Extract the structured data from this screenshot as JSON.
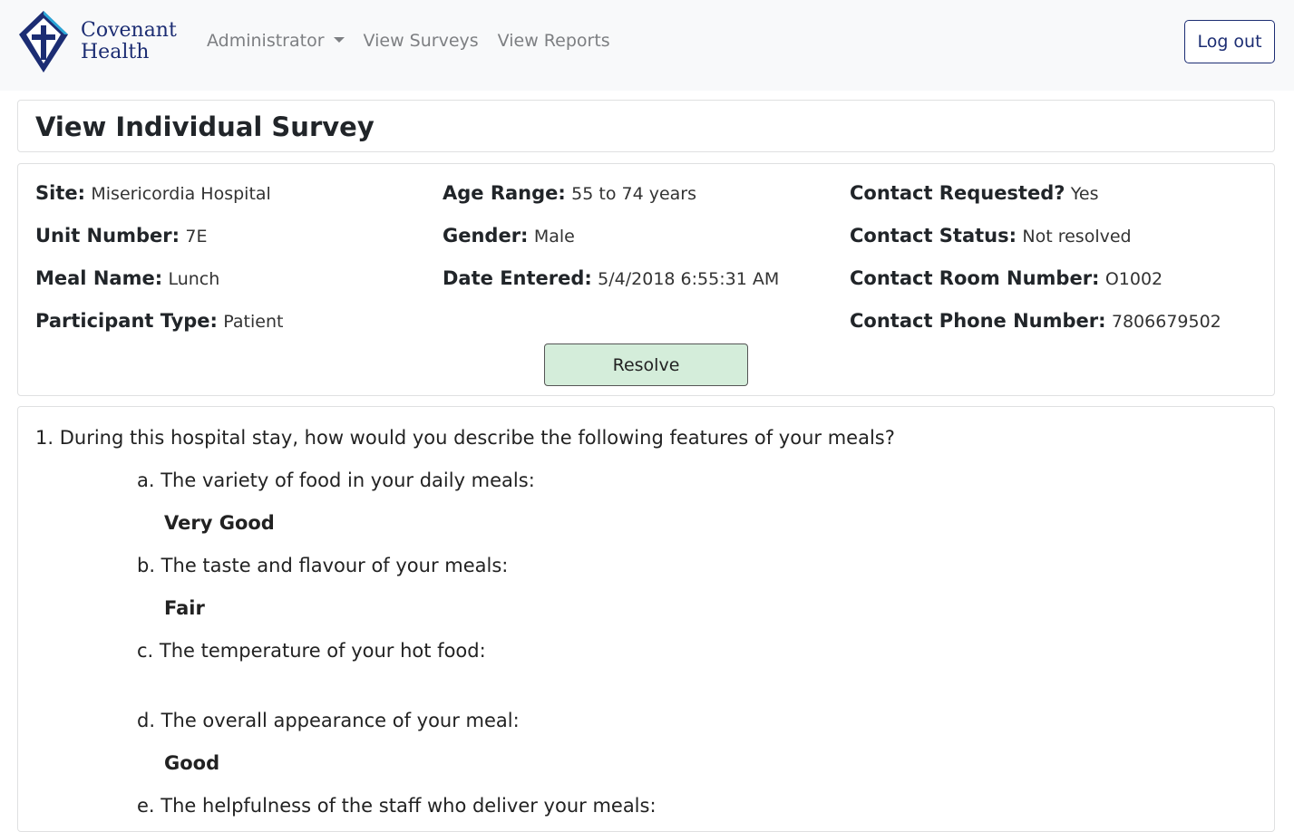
{
  "brand": {
    "line1": "Covenant",
    "line2": "Health"
  },
  "nav": {
    "admin_label": "Administrator",
    "surveys_label": "View Surveys",
    "reports_label": "View Reports",
    "logout_label": "Log out"
  },
  "page_title": "View Individual Survey",
  "info": {
    "col1": [
      {
        "label": "Site:",
        "value": "Misericordia Hospital"
      },
      {
        "label": "Unit Number:",
        "value": "7E"
      },
      {
        "label": "Meal Name:",
        "value": "Lunch"
      },
      {
        "label": "Participant Type:",
        "value": "Patient"
      }
    ],
    "col2": [
      {
        "label": "Age Range:",
        "value": "55 to 74 years"
      },
      {
        "label": "Gender:",
        "value": "Male"
      },
      {
        "label": "Date Entered:",
        "value": "5/4/2018 6:55:31 AM"
      }
    ],
    "col3": [
      {
        "label": "Contact Requested?",
        "value": "Yes"
      },
      {
        "label": "Contact Status:",
        "value": "Not resolved"
      },
      {
        "label": "Contact Room Number:",
        "value": "O1002"
      },
      {
        "label": "Contact Phone Number:",
        "value": "7806679502"
      }
    ],
    "resolve_label": "Resolve"
  },
  "question": {
    "text": "1. During this hospital stay, how would you describe the following features of your meals?",
    "items": [
      {
        "q": "a. The variety of food in your daily meals:",
        "a": "Very Good"
      },
      {
        "q": "b. The taste and flavour of your meals:",
        "a": "Fair"
      },
      {
        "q": "c. The temperature of your hot food:",
        "a": ""
      },
      {
        "q": "d. The overall appearance of your meal:",
        "a": "Good"
      },
      {
        "q": "e. The helpfulness of the staff who deliver your meals:",
        "a": ""
      }
    ]
  }
}
